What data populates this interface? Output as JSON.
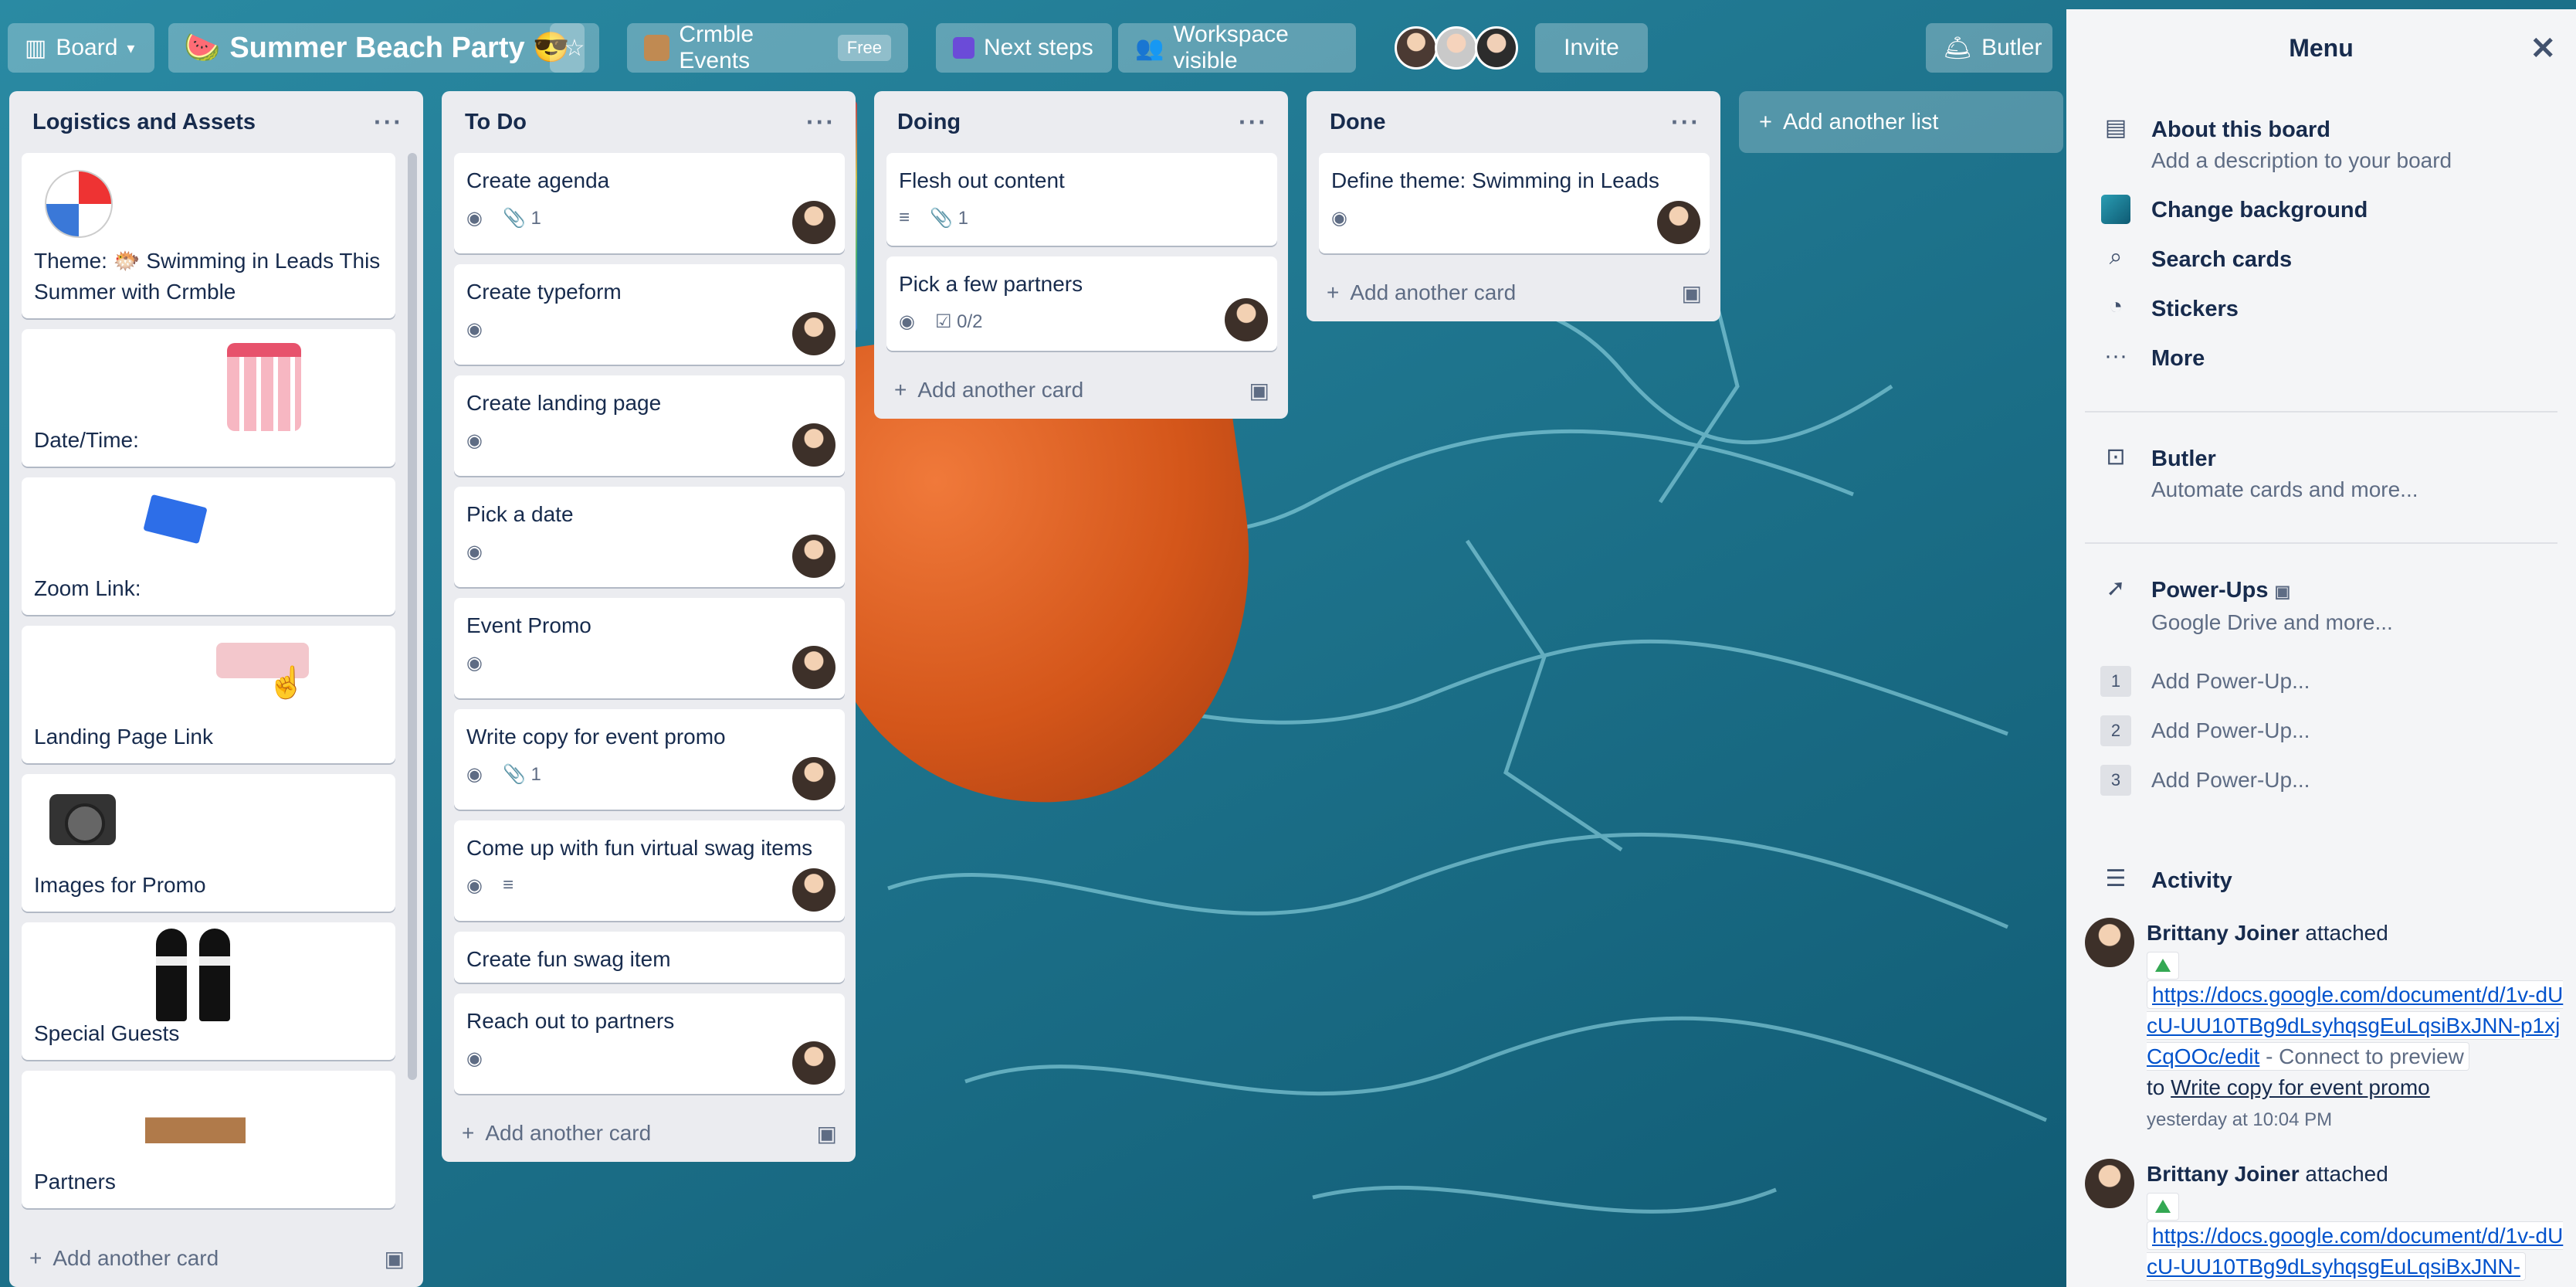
{
  "topbar": {
    "board_menu": "Board",
    "board_title": "Summer Beach Party 😎",
    "board_emoji": "🍉",
    "workspace": "Crmble Events",
    "workspace_badge": "Free",
    "next_steps": "Next steps",
    "visibility": "Workspace visible",
    "invite": "Invite",
    "butler": "Butler"
  },
  "lists": {
    "logistics": {
      "title": "Logistics and Assets",
      "cards": [
        "Theme: 🐡 Swimming in Leads This Summer with Crmble",
        "Date/Time:",
        "Zoom Link:",
        "Landing Page Link",
        "Images for Promo",
        "Special Guests",
        "Partners"
      ],
      "add": "Add another card"
    },
    "todo": {
      "title": "To Do",
      "cards": [
        {
          "title": "Create agenda",
          "attach": "1"
        },
        {
          "title": "Create typeform"
        },
        {
          "title": "Create landing page"
        },
        {
          "title": "Pick a date"
        },
        {
          "title": "Event Promo"
        },
        {
          "title": "Write copy for event promo",
          "attach": "1"
        },
        {
          "title": "Come up with fun virtual swag items"
        },
        {
          "title": "Create fun swag item"
        },
        {
          "title": "Reach out to partners"
        }
      ],
      "add": "Add another card"
    },
    "doing": {
      "title": "Doing",
      "cards": [
        {
          "title": "Flesh out content",
          "attach": "1"
        },
        {
          "title": "Pick a few partners",
          "checklist": "0/2"
        }
      ],
      "add": "Add another card"
    },
    "done": {
      "title": "Done",
      "cards": [
        {
          "title": "Define theme: Swimming in Leads"
        }
      ],
      "add": "Add another card"
    },
    "add_list": "Add another list"
  },
  "menu": {
    "title": "Menu",
    "about_title": "About this board",
    "about_sub": "Add a description to your board",
    "change_bg": "Change background",
    "search": "Search cards",
    "stickers": "Stickers",
    "more": "More",
    "butler_title": "Butler",
    "butler_sub": "Automate cards and more...",
    "powerups_title": "Power-Ups",
    "powerups_sub": "Google Drive and more...",
    "powerups": [
      {
        "num": "1",
        "label": "Add Power-Up..."
      },
      {
        "num": "2",
        "label": "Add Power-Up..."
      },
      {
        "num": "3",
        "label": "Add Power-Up..."
      }
    ],
    "activity_title": "Activity",
    "activity": [
      {
        "user": "Brittany Joiner",
        "action": "attached",
        "link": "https://docs.google.com/document/d/1v-dUcU-UU10TBg9dLsyhqsgEuLqsiBxJNN-p1xjCqOOc/edit",
        "preview": "- Connect to preview",
        "to": "to",
        "card": "Write copy for event promo",
        "time": "yesterday at 10:04 PM"
      },
      {
        "user": "Brittany Joiner",
        "action": "attached",
        "link": "https://docs.google.com/document/d/1v-dUcU-UU10TBg9dLsyhqsgEuLqsiBxJNN-"
      }
    ]
  }
}
